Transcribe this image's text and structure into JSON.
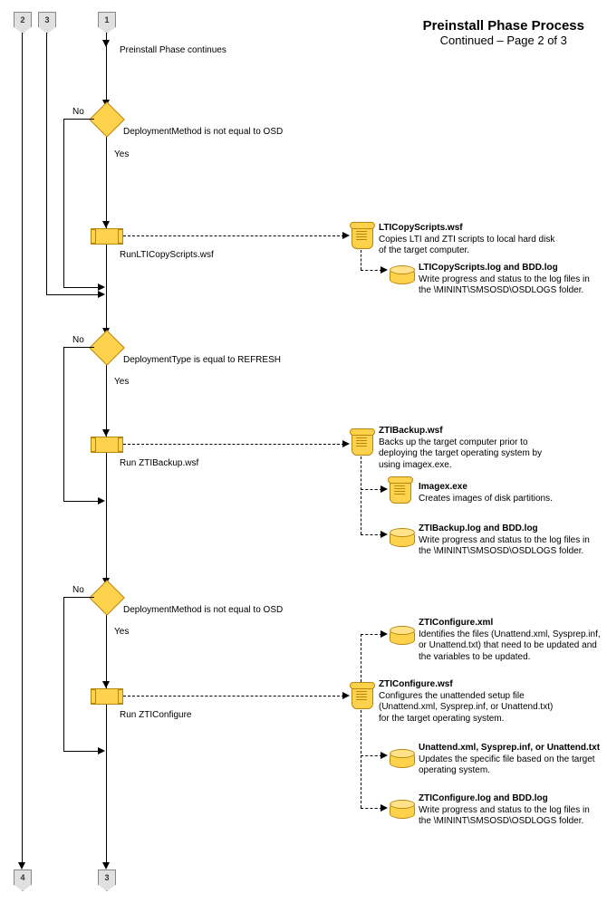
{
  "title": {
    "line1": "Preinstall Phase Process",
    "line2": "Continued – Page 2 of 3"
  },
  "connectors": {
    "top": {
      "c1": "2",
      "c2": "3",
      "c3": "1"
    },
    "bottom": {
      "b1": "4",
      "b2": "3"
    }
  },
  "start_label": "Preinstall Phase continues",
  "labels": {
    "no": "No",
    "yes": "Yes"
  },
  "d1": {
    "text": "DeploymentMethod is not equal to OSD"
  },
  "p1": {
    "text": "RunLTICopyScripts.wsf"
  },
  "r1a": {
    "hd": "LTICopyScripts.wsf",
    "body": "Copies LTI and ZTI scripts to local hard disk of the target computer."
  },
  "r1b": {
    "hd": "LTICopyScripts.log and BDD.log",
    "body": "Write progress and status to the log files in the \\MININT\\SMSOSD\\OSDLOGS folder."
  },
  "d2": {
    "text": "DeploymentType is equal to REFRESH"
  },
  "p2": {
    "text": "Run ZTIBackup.wsf"
  },
  "r2a": {
    "hd": "ZTIBackup.wsf",
    "body": "Backs up the target computer prior to deploying the target operating system by using imagex.exe."
  },
  "r2b": {
    "hd": "Imagex.exe",
    "body": "Creates images of disk partitions."
  },
  "r2c": {
    "hd": "ZTIBackup.log and BDD.log",
    "body": "Write progress and status to the log files in the \\MININT\\SMSOSD\\OSDLOGS folder."
  },
  "d3": {
    "text": "DeploymentMethod is not equal to OSD"
  },
  "p3": {
    "text": "Run ZTIConfigure"
  },
  "r3a": {
    "hd": "ZTIConfigure.xml",
    "body": "Identifies the files (Unattend.xml, Sysprep.inf, or Unattend.txt) that need to be updated and the variables to be updated."
  },
  "r3b": {
    "hd": "ZTIConfigure.wsf",
    "body": "Configures the unattended setup file (Unattend.xml, Sysprep.inf, or Unattend.txt) for the target operating system."
  },
  "r3c": {
    "hd": "Unattend.xml, Sysprep.inf, or Unattend.txt",
    "body": "Updates the specific file based on the target operating system."
  },
  "r3d": {
    "hd": "ZTIConfigure.log and BDD.log",
    "body": "Write progress and status to the log files in the \\MININT\\SMSOSD\\OSDLOGS folder."
  }
}
